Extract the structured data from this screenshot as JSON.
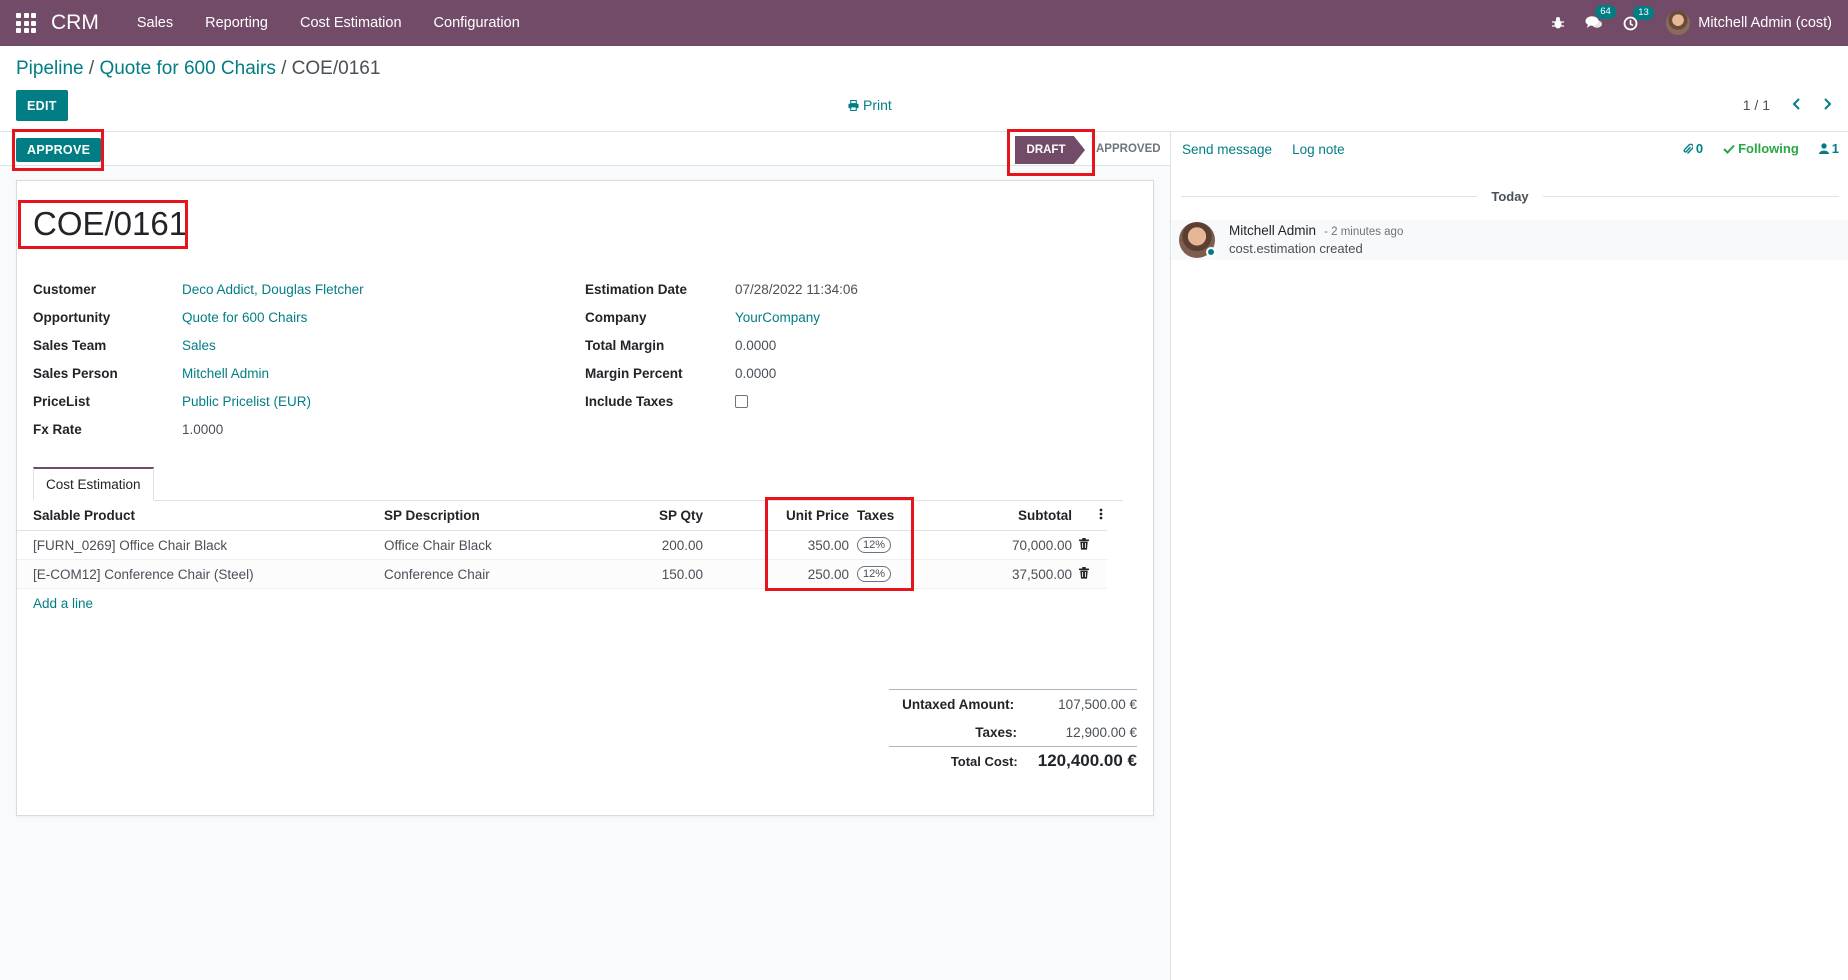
{
  "navbar": {
    "brand": "CRM",
    "menu": [
      "Sales",
      "Reporting",
      "Cost Estimation",
      "Configuration"
    ],
    "messages_count": "64",
    "activities_count": "13",
    "user_name": "Mitchell Admin (cost)"
  },
  "breadcrumb": {
    "pipeline": "Pipeline",
    "sep1": " / ",
    "opportunity": "Quote for 600 Chairs",
    "sep2": " / ",
    "current": "COE/0161"
  },
  "actions": {
    "edit": "EDIT",
    "print": "Print",
    "pager": "1 / 1"
  },
  "statusbar": {
    "approve": "APPROVE",
    "stage_draft": "DRAFT",
    "stage_approved": "APPROVED"
  },
  "record": {
    "name": "COE/0161"
  },
  "fields_left": {
    "customer_label": "Customer",
    "customer": "Deco Addict, Douglas Fletcher",
    "opportunity_label": "Opportunity",
    "opportunity": "Quote for 600 Chairs",
    "team_label": "Sales Team",
    "team": "Sales",
    "person_label": "Sales Person",
    "person": "Mitchell Admin",
    "pricelist_label": "PriceList",
    "pricelist": "Public Pricelist (EUR)",
    "fx_label": "Fx Rate",
    "fx": "1.0000"
  },
  "fields_right": {
    "date_label": "Estimation Date",
    "date": "07/28/2022 11:34:06",
    "company_label": "Company",
    "company": "YourCompany",
    "margin_label": "Total Margin",
    "margin": "0.0000",
    "percent_label": "Margin Percent",
    "percent": "0.0000",
    "taxes_label": "Include Taxes"
  },
  "tabs": {
    "cost_estimation": "Cost Estimation"
  },
  "table": {
    "headers": {
      "product": "Salable Product",
      "description": "SP Description",
      "qty": "SP Qty",
      "unit_price": "Unit Price",
      "taxes": "Taxes",
      "subtotal": "Subtotal"
    },
    "rows": [
      {
        "product": "[FURN_0269] Office Chair Black",
        "description": "Office Chair Black",
        "qty": "200.00",
        "unit_price": "350.00",
        "tax": "12%",
        "subtotal": "70,000.00"
      },
      {
        "product": "[E-COM12] Conference Chair (Steel)",
        "description": "Conference Chair",
        "qty": "150.00",
        "unit_price": "250.00",
        "tax": "12%",
        "subtotal": "37,500.00"
      }
    ],
    "add_line": "Add a line"
  },
  "totals": {
    "untaxed_label": "Untaxed Amount:",
    "untaxed": "107,500.00 €",
    "taxes_label": "Taxes:",
    "taxes": "12,900.00 €",
    "total_label": "Total Cost:",
    "total": "120,400.00 €"
  },
  "chatter": {
    "send_message": "Send message",
    "log_note": "Log note",
    "attachments": "0",
    "following": "Following",
    "followers": "1",
    "day": "Today",
    "message": {
      "author": "Mitchell Admin",
      "date": "- 2 minutes ago",
      "body": "cost.estimation created"
    }
  },
  "colors": {
    "brand": "#714b67",
    "accent": "#017e84",
    "highlight": "#e8141b"
  }
}
